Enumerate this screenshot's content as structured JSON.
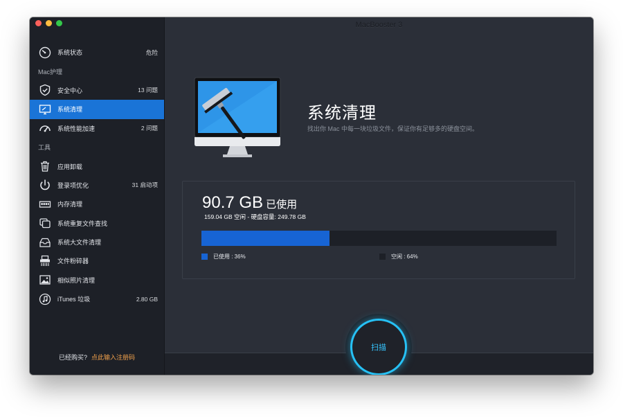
{
  "window": {
    "title": "MacBooster 3"
  },
  "sidebar": {
    "items": [
      {
        "label": "系统状态",
        "count": "危险",
        "icon": "gauge-icon"
      },
      {
        "header": "Mac护理"
      },
      {
        "label": "安全中心",
        "count": "13 问题",
        "icon": "shield-icon"
      },
      {
        "label": "系统清理",
        "count": "",
        "icon": "monitor-icon",
        "active": true
      },
      {
        "label": "系统性能加速",
        "count": "2 问题",
        "icon": "speedometer-icon"
      },
      {
        "header": "工具"
      },
      {
        "label": "应用卸载",
        "count": "",
        "icon": "trash-icon"
      },
      {
        "label": "登录项优化",
        "count": "31 启动项",
        "icon": "power-icon"
      },
      {
        "label": "内存清理",
        "count": "",
        "icon": "memory-icon"
      },
      {
        "label": "系统重复文件查找",
        "count": "",
        "icon": "duplicate-files-icon"
      },
      {
        "label": "系统大文件清理",
        "count": "",
        "icon": "large-files-icon"
      },
      {
        "label": "文件粉碎器",
        "count": "",
        "icon": "shredder-icon"
      },
      {
        "label": "相似照片清理",
        "count": "",
        "icon": "photo-icon"
      },
      {
        "label": "iTunes 垃圾",
        "count": "2.80 GB",
        "icon": "music-note-icon"
      }
    ],
    "footer": {
      "text": "已经购买?",
      "link": "点此输入注册码"
    }
  },
  "main": {
    "title": "系统清理",
    "subtitle": "找出你 Mac 中每一块垃圾文件，保证你有足够多的硬盘空间。",
    "disk": {
      "used_value": "90.7 GB",
      "used_label": "已使用",
      "detail": "159.04 GB 空闲 - 硬盘容量:  249.78 GB",
      "used_percent": 36,
      "legend_used": "已使用 : 36%",
      "legend_free": "空闲 : 64%"
    },
    "scan_button": "扫描"
  },
  "colors": {
    "accent": "#1a74d7",
    "bar_used": "#1764d4",
    "scan_ring": "#26c1f5",
    "link": "#f0a04b"
  }
}
